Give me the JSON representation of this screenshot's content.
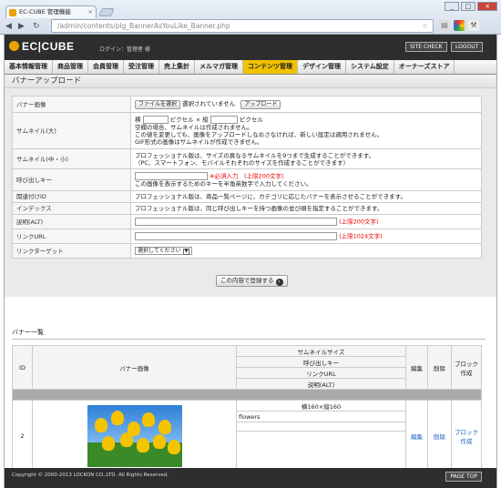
{
  "browser": {
    "tab_title": "EC-CUBE 管理機能",
    "tab_close": "×",
    "new_tab": "",
    "url_host": "/admin/contents/plg_BannerAsYouLike_Banner.php",
    "back": "◀",
    "forward": "▶",
    "reload": "↻",
    "minimize": "_",
    "maximize": "□",
    "close": "×"
  },
  "header": {
    "logo": "EC|CUBE",
    "login": "ログイン：管理者 様",
    "site_check": "SITE CHECK",
    "logout": "LOGOUT"
  },
  "menu": {
    "items": [
      "基本情報管理",
      "商品管理",
      "会員管理",
      "受注管理",
      "売上集計",
      "メルマガ管理",
      "コンテンツ管理",
      "デザイン管理",
      "システム設定",
      "オーナーズストア"
    ],
    "active": "コンテンツ管理"
  },
  "page": {
    "title": "バナーアップロード"
  },
  "form": {
    "banner_image_label": "バナー画像",
    "file_button": "ファイルを選択",
    "file_status": "選択されていません",
    "upload_button": "アップロード",
    "thumb_large_label": "サムネイル(大)",
    "width_label": "横",
    "pixel_x": "ピクセル × 縦",
    "pixel": "ピクセル",
    "thumb_note1": "空欄の場合、サムネイルは作成されません。",
    "thumb_note2": "この値を変更しても、画像をアップロードしなおさなければ、新しい設定は適用されません。",
    "thumb_note3": "GIF形式の画像はサムネイルが作成できません。",
    "thumb_mid_label": "サムネイル(中・小)",
    "thumb_mid_note1": "プロフェッショナル版は、サイズの異なるサムネイルを9つまで生成することができます。",
    "thumb_mid_note2": "（PC、スマートフォン、モバイルそれぞれのサイズを作成することができます）",
    "callkey_label": "呼び出しキー",
    "callkey_required": "※必須入力　(上限200文字)",
    "callkey_note": "この画像を表示するためのキーを半角英数字で入力してください。",
    "related_label": "関連付けID",
    "related_note": "プロフェッショナル版は、商品一覧ページに、カテゴリに応じたバナーを表示させることができます。",
    "index_label": "インデックス",
    "index_note": "プロフェッショナル版は、同じ呼び出しキーを持つ画像の並び順を指定することができます。",
    "alt_label": "説明(ALT)",
    "alt_limit": "(上限200文字)",
    "url_label": "リンクURL",
    "url_limit": "(上限1024文字)",
    "target_label": "リンクターゲット",
    "target_value": "選択してください",
    "save_button": "この内容で登録する"
  },
  "list": {
    "section_title": "バナー一覧",
    "col_id": "ID",
    "col_image": "バナー画像",
    "col_thumb_size": "サムネイルサイズ",
    "col_callkey": "呼び出しキー",
    "col_url": "リンクURL",
    "col_alt": "説明(ALT)",
    "col_edit": "編集",
    "col_delete": "削除",
    "col_block": "ブロック作成",
    "rows": [
      {
        "id": "2",
        "thumb_size": "横160×縦160",
        "callkey": "flowers",
        "edit": "編集",
        "delete": "削除",
        "block": "ブロック作成"
      }
    ]
  },
  "footer": {
    "copyright": "Copyright © 2000-2013 LOCKON CO.,LTD. All Rights Reserved.",
    "page_top": "PAGE TOP"
  },
  "colors": {
    "accent": "#f2c200",
    "header_bg": "#2e2e2e",
    "required": "#e00000",
    "link": "#1a5fbf"
  }
}
